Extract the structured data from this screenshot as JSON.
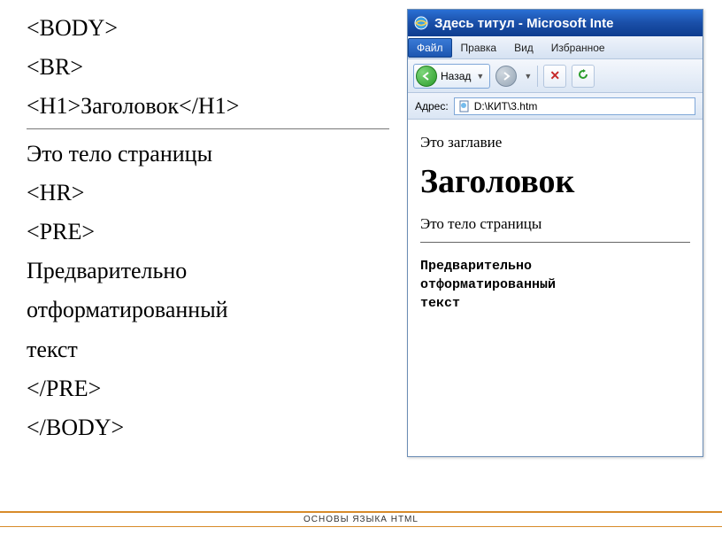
{
  "code_lines": {
    "l1": "<BODY>",
    "l2": "<BR>",
    "l3": "<H1>Заголовок</H1>",
    "l4": "Это тело страницы",
    "l5": "<HR>",
    "l6": "<PRE>",
    "l7": "Предварительно",
    "l8": "отформатированный",
    "l9": "текст",
    "l10": "</PRE>",
    "l11": "</BODY>"
  },
  "browser": {
    "title": "Здесь титул - Microsoft Inte",
    "menu": {
      "file": "Файл",
      "edit": "Правка",
      "view": "Вид",
      "favorites": "Избранное"
    },
    "toolbar": {
      "back_label": "Назад"
    },
    "address": {
      "label": "Адрес:",
      "value": "D:\\КИТ\\3.htm"
    },
    "page": {
      "subtitle": "Это заглавие",
      "heading": "Заголовок",
      "body": "Это тело страницы",
      "pre1": "Предварительно",
      "pre2": "отформатированный",
      "pre3": "текст"
    }
  },
  "footer": "ОСНОВЫ ЯЗЫКА HTML"
}
